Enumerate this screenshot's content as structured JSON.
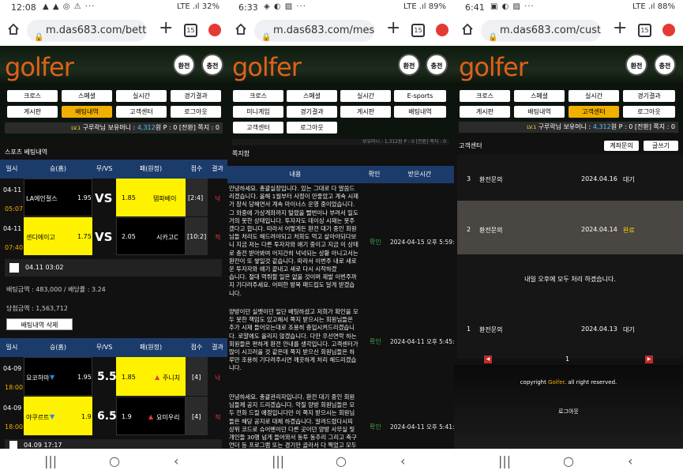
{
  "p1": {
    "status": {
      "time": "12:08",
      "icons": "▲ ▲ ◎ ⚠ ···",
      "battery": "LTE .ıl 32%"
    },
    "url": "m.das683.com/betting",
    "tabs": "15",
    "logo": "golfer",
    "btn_left": "환전",
    "btn_right": "충전",
    "menu": [
      "크로스",
      "스페셜",
      "실시간",
      "경기결과",
      "게시판",
      "배팅내역",
      "고객센터",
      "로그아웃"
    ],
    "info": {
      "lv": "LV.1",
      "user": "구루락",
      "balance_label": "님 보유머니 :",
      "balance": "4,312",
      "unit": "원",
      "point": "P : 0",
      "extra": "[전환]",
      "note": "쪽지 : 0"
    },
    "section_title": "스포츠 베팅내역",
    "headers": [
      "일시",
      "승(홈)",
      "무/VS",
      "패(원정)",
      "점수",
      "결과"
    ],
    "rows1": [
      {
        "date": "04-11",
        "time": "05:07",
        "home": "LA에인절스",
        "hodd": "1.95",
        "vs": "VS",
        "aodd": "1.85",
        "away": "템파베이",
        "score": "[2:4]",
        "res": "낙"
      },
      {
        "date": "04-11",
        "time": "07:40",
        "home": "샌디에이고",
        "hodd": "1.75",
        "vs": "VS",
        "aodd": "2.05",
        "away": "시카고C",
        "score": "[10:2]",
        "res": "적"
      }
    ],
    "slip1": {
      "date": "04.11 03:02",
      "amount": "배팅금액 : 483,000 / 배당률 : 3.24",
      "win": "당첨금액 : 1,563,712",
      "delete": "배팅내역 삭제"
    },
    "rows2": [
      {
        "date": "04-09",
        "time": "18:00",
        "home": "요코하마",
        "hodd": "1.95",
        "vs": "5.5",
        "aodd": "1.85",
        "away": "주니치",
        "score": "[4]",
        "res": "낙"
      },
      {
        "date": "04-09",
        "time": "18:00",
        "home": "야쿠르트",
        "hodd": "1.9",
        "vs": "6.5",
        "aodd": "1.9",
        "away": "요미우리",
        "score": "[4]",
        "res": "적"
      }
    ],
    "slip2_date": "04.09 17:17"
  },
  "p2": {
    "status": {
      "time": "6:33",
      "icons": "◈ ◐ ▨ ···",
      "battery": "LTE .ıl 89%"
    },
    "url": "m.das683.com/message",
    "tabs": "15",
    "logo": "golfer",
    "btn_left": "환전",
    "btn_right": "충전",
    "menu": [
      "크로스",
      "스페셜",
      "실시간",
      "E-sports",
      "미니게임",
      "경기결과",
      "게시판",
      "배팅내역",
      "고객센터",
      "로그아웃"
    ],
    "info": "보유머니 : 1,312원 P : 0 [전환] 쪽지 : 0",
    "section_title": "쪽지함",
    "headers": [
      "내용",
      "확인",
      "받은시간"
    ],
    "msgs": [
      {
        "lines": [
          "안녕하세요. 총괄실장입니다. 있는 그대로 다 말씀드",
          "리겠습니다. 올해 1월부터 사정이 안좋았고 계속 시재",
          "가 장식 당해면서 계속 마이너스 운영 중이었습니다.",
          "그 와중에 가상계좌까지 털렸을 뻘번이나 부려서 일도",
          "거의 못한 상태입니다. 투자자도 데이싱 시재는 못주",
          "겠다고 합니다. 따라서 어떻게든 환전 대기 중인 회원",
          "님들 처리도 해드려야되고 처회도 먹고 살아야되다보",
          "니 지금 저는 다른 투자자와 얘기 중이고 지금 이 상태",
          "로 충전 받아봐여 어지간히 넉넉되는 상황 아니고서는",
          "환전이 또 쌓일것 같습니다. 따라서 이번주 내로 새로",
          "운 투자자와 얘기 끝내고 새로 다시 시작하겠",
          "습니다. 절대 먹튀할 일은 없을 것이며 제발 이번주까",
          "지 기다려주세요. 어떠한 방목 패드립도 달게 받겠습",
          "니다."
        ],
        "check": "확인",
        "time": "2024-04-15 오후 5:59:58"
      },
      {
        "lines": [
          "양방이던 실벳이던 일단 배팅하셨고 저희가 확인을 모",
          "두 못한 책임도 있고해서 쪽지 받으시는 회원님들은",
          "추가 시재 들어오는대로 조용히 충입시켜드리겠습니",
          "다. 로얄에도 올리지 않겠습니다. 다만 우선연락 하는",
          "회원들은 편하게 환전 안내를 생각입니다. 고객센터가",
          "많이 시끄러울 것 같은데 쪽지 받으신 회원님들은 하",
          "루만 조용히 기다려주시면 깨끗하게 처리 해드리겠습",
          "니다."
        ],
        "check": "확인",
        "time": "2024-04-11 오후 5:45:13"
      },
      {
        "lines": [
          "안녕하세요. 총괄관리자입니다. 환전 대기 중인 회원",
          "님들께 공지 드리겠습니다. 악질 양방 회원님들은 모",
          "두 전화 드릴 예정입니다만 이 쪽지 받으시는 회원님",
          "들은 해당 공지로 대체 하겠습니다. 알려드렸다시피",
          "상위 코드로 슈어벤이던 다른 곳이던 양방 사무실 및",
          "개인들 30명 넘게 들어와서 동투 동추리 그리고 축구",
          "언더 등 프로그램 또는 경기만 골라서 다 찍었고 모두",
          "당첨된 상황입니다. 환전 시재가 약 1억 가까이 되고"
        ],
        "check": "확인",
        "time": "2024-04-11 오후 5:41:49"
      }
    ]
  },
  "p3": {
    "status": {
      "time": "6:41",
      "icons": "▣ ◐ ▨ ···",
      "battery": "LTE .ıl 88%"
    },
    "url": "m.das683.com/customer",
    "tabs": "15",
    "logo": "golfer",
    "btn_left": "환전",
    "btn_right": "충전",
    "menu": [
      "크로스",
      "스페셜",
      "실시간",
      "경기결과",
      "게시판",
      "배팅내역",
      "고객센터",
      "로그아웃"
    ],
    "info": {
      "lv": "LV.1",
      "user": "구루락",
      "balance_label": "님 보유머니 :",
      "balance": "4,312",
      "unit": "원",
      "point": "P : 0",
      "extra": "[전환]",
      "note": "쪽지 : 0"
    },
    "section_title": "고객센터",
    "btn_account": "계좌문의",
    "btn_write": "글쓰기",
    "posts": [
      {
        "no": "3",
        "title": "환전문의",
        "date": "2024.04.16",
        "status": "대기"
      },
      {
        "no": "2",
        "title": "환전문의",
        "date": "2024.04.14",
        "status": "완료"
      },
      {
        "no": "1",
        "title": "환전문의",
        "date": "2024.04.13",
        "status": "대기"
      }
    ],
    "reply": "내일 오후에 모두 처리 하겠습니다.",
    "page": "1",
    "copyright_pre": "copyright ",
    "copyright_brand": "Golfer",
    "copyright_post": ". all right reserved.",
    "logout": "로그아웃"
  },
  "nav": {
    "recent": "|||",
    "home": "○",
    "back": "‹"
  }
}
